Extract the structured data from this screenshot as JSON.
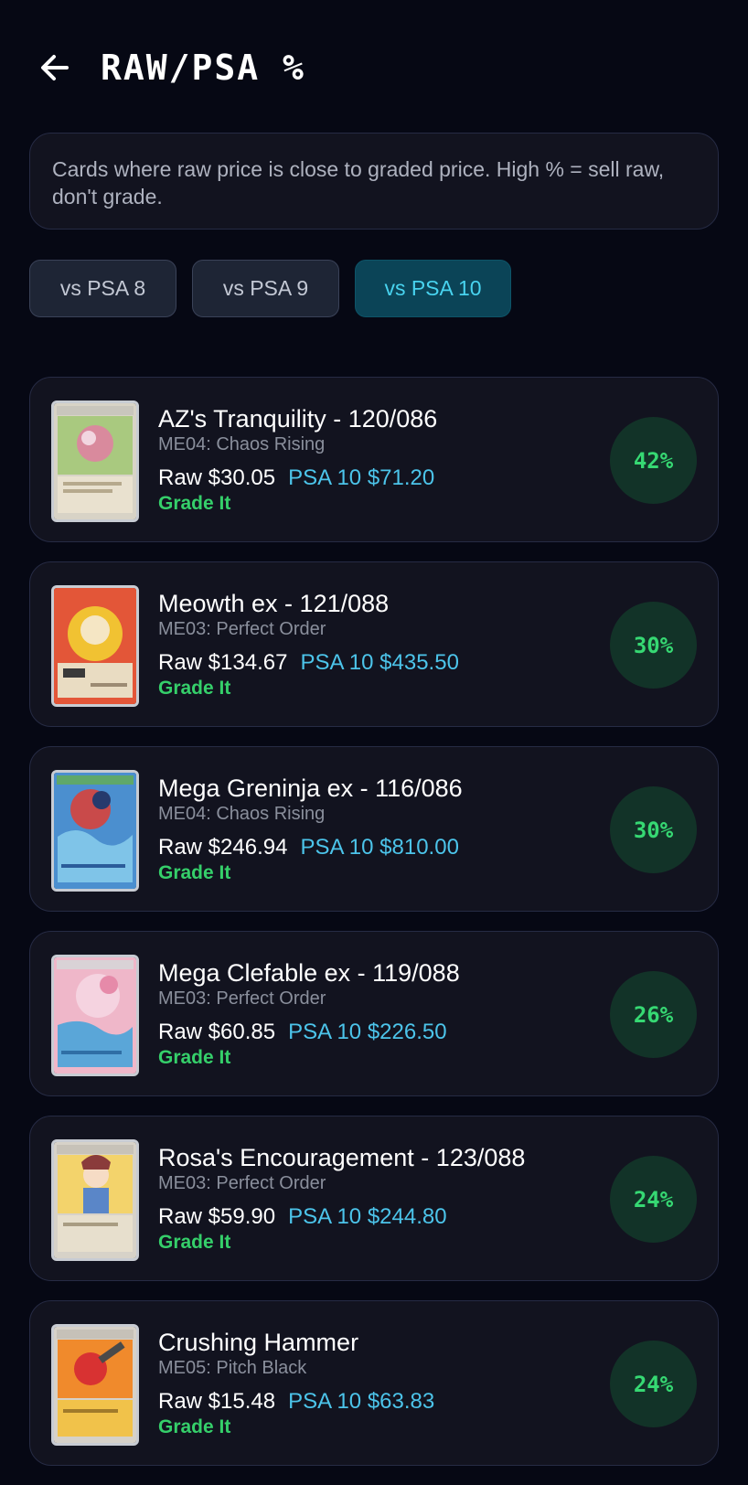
{
  "header": {
    "title": "RAW/PSA %",
    "back_icon": "arrow-left-icon"
  },
  "description": "Cards where raw price is close to graded price. High % = sell raw, don't grade.",
  "tabs": [
    {
      "label": "vs PSA 8",
      "active": false
    },
    {
      "label": "vs PSA 9",
      "active": false
    },
    {
      "label": "vs PSA 10",
      "active": true
    }
  ],
  "colors": {
    "background": "#060814",
    "panel": "#12131f",
    "accent_cyan": "#4cc4ea",
    "accent_green": "#35cf6a",
    "active_tab": "#0b4457"
  },
  "cards": [
    {
      "name": "AZ's Tranquility - 120/086",
      "set": "ME04: Chaos Rising",
      "raw": "Raw $30.05",
      "psa": "PSA 10 $71.20",
      "action": "Grade It",
      "percent": "42%"
    },
    {
      "name": "Meowth ex - 121/088",
      "set": "ME03: Perfect Order",
      "raw": "Raw $134.67",
      "psa": "PSA 10 $435.50",
      "action": "Grade It",
      "percent": "30%"
    },
    {
      "name": "Mega Greninja ex - 116/086",
      "set": "ME04: Chaos Rising",
      "raw": "Raw $246.94",
      "psa": "PSA 10 $810.00",
      "action": "Grade It",
      "percent": "30%"
    },
    {
      "name": "Mega Clefable ex - 119/088",
      "set": "ME03: Perfect Order",
      "raw": "Raw $60.85",
      "psa": "PSA 10 $226.50",
      "action": "Grade It",
      "percent": "26%"
    },
    {
      "name": "Rosa's Encouragement - 123/088",
      "set": "ME03: Perfect Order",
      "raw": "Raw $59.90",
      "psa": "PSA 10 $244.80",
      "action": "Grade It",
      "percent": "24%"
    },
    {
      "name": "Crushing Hammer",
      "set": "ME05: Pitch Black",
      "raw": "Raw $15.48",
      "psa": "PSA 10 $63.83",
      "action": "Grade It",
      "percent": "24%"
    }
  ]
}
